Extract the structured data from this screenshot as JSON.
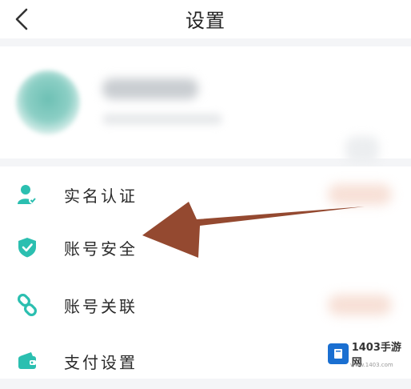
{
  "header": {
    "title": "设置"
  },
  "menu": {
    "items": [
      {
        "label": "实名认证",
        "icon": "id-user-icon"
      },
      {
        "label": "账号安全",
        "icon": "shield-check-icon"
      },
      {
        "label": "账号关联",
        "icon": "link-chain-icon"
      },
      {
        "label": "支付设置",
        "icon": "wallet-icon"
      }
    ]
  },
  "colors": {
    "accent": "#2bbfb0",
    "arrow": "#8b3a1e"
  },
  "watermark": {
    "text": "1403手游网",
    "sub": "www.1403.com"
  }
}
